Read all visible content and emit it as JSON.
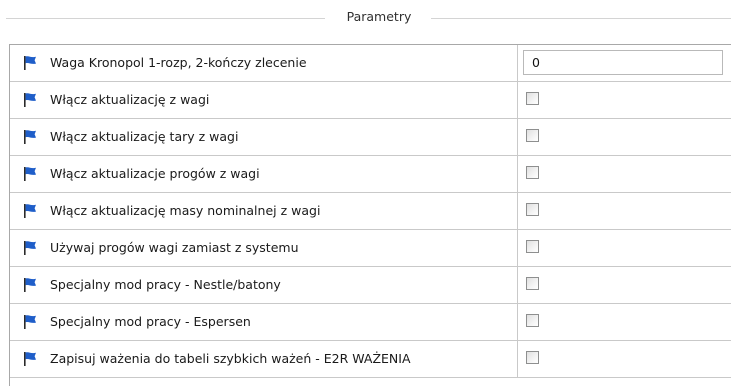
{
  "group": {
    "title": "Parametry"
  },
  "params": [
    {
      "label": "Waga Kronopol 1-rozp, 2-kończy zlecenie",
      "type": "text",
      "value": "0"
    },
    {
      "label": "Włącz aktualizację z wagi",
      "type": "checkbox",
      "checked": false
    },
    {
      "label": "Włącz aktualizację tary z wagi",
      "type": "checkbox",
      "checked": false
    },
    {
      "label": "Włącz aktualizacje progów z wagi",
      "type": "checkbox",
      "checked": false
    },
    {
      "label": "Włącz aktualizację masy nominalnej z wagi",
      "type": "checkbox",
      "checked": false
    },
    {
      "label": "Używaj progów wagi zamiast z systemu",
      "type": "checkbox",
      "checked": false
    },
    {
      "label": "Specjalny mod pracy - Nestle/batony",
      "type": "checkbox",
      "checked": false
    },
    {
      "label": "Specjalny mod pracy - Espersen",
      "type": "checkbox",
      "checked": false
    },
    {
      "label": "Zapisuj ważenia do tabeli szybkich ważeń - E2R WAŻENIA",
      "type": "checkbox",
      "checked": false
    }
  ],
  "colors": {
    "flag": "#1f5ec9",
    "flag_pole": "#2a2a2a",
    "grid": "#c9c9c9"
  },
  "icons": {
    "row_icon": "flag-icon"
  }
}
